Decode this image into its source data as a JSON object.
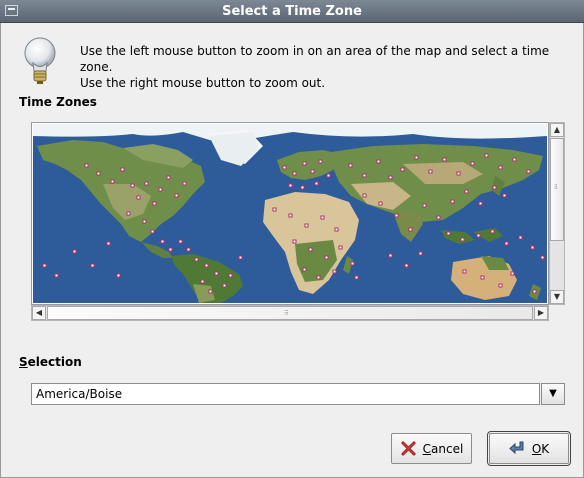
{
  "window": {
    "title": "Select a Time Zone"
  },
  "intro": {
    "line1": "Use the left mouse button to zoom in on an area of the map and select a time zone.",
    "line2": "Use the right mouse button to zoom out."
  },
  "map_section": {
    "label": "Time Zones"
  },
  "selection": {
    "label_underlined": "S",
    "label_rest": "election",
    "value": "America/Boise"
  },
  "buttons": {
    "cancel": {
      "underlined": "C",
      "rest": "ancel"
    },
    "ok": {
      "underlined": "O",
      "rest": "K"
    }
  },
  "icons": {
    "bulb": "lightbulb-icon",
    "cancel": "cancel-x-icon",
    "ok": "ok-arrow-icon",
    "dropdown": "chevron-down-icon"
  },
  "colors": {
    "ocean": "#2e5b99",
    "land": "#6f8e4a",
    "desert": "#d8c59a",
    "marker": "#d04a8b"
  }
}
